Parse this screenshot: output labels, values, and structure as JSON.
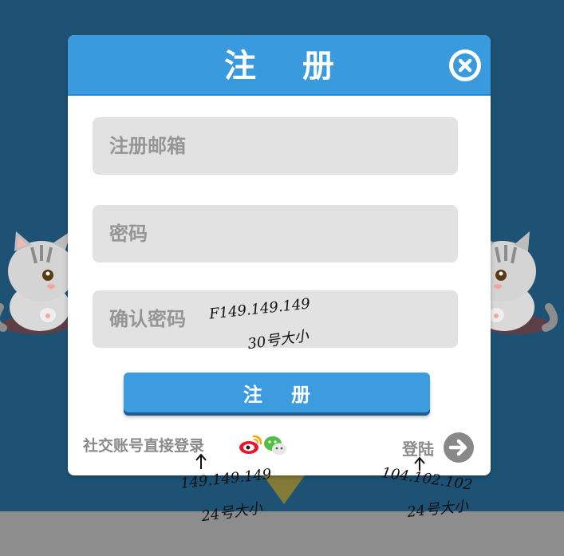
{
  "dialog": {
    "title": "注 册",
    "close_icon": "close-circle-icon"
  },
  "form": {
    "email_placeholder": "注册邮箱",
    "password_placeholder": "密码",
    "confirm_placeholder": "确认密码",
    "submit_label": "注 册"
  },
  "footer": {
    "social_label": "社交账号直接登录",
    "weibo_icon": "weibo-icon",
    "wechat_icon": "wechat-icon",
    "login_label": "登陆",
    "login_icon": "arrow-right-circle-icon"
  },
  "annotations": {
    "confirm_color": "F149.149.149",
    "confirm_size": "30号大小",
    "social_color": "149.149.149",
    "social_size": "24号大小",
    "login_color": "104.102.102",
    "login_size": "24号大小"
  },
  "colors": {
    "background": "#1e5275",
    "header": "#3a9ade",
    "button": "#3d9be0",
    "input_bg": "#e2e2e2",
    "input_text": "#959595"
  }
}
